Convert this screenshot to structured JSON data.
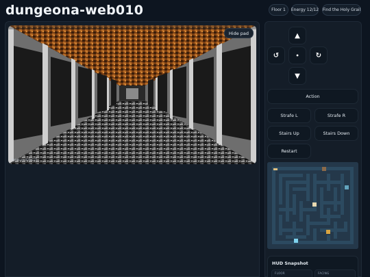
{
  "app": {
    "title": "dungeona-web010"
  },
  "status": {
    "floor": "Floor 1",
    "energy": "Energy 12/12",
    "quest": "Find the Holy Grail"
  },
  "viewport": {
    "hide_pad_label": "Hide pad",
    "render_info": "Renderer 400x225"
  },
  "controls": {
    "forward": "▲",
    "turn_left": "↺",
    "center": "•",
    "turn_right": "↻",
    "back": "▼"
  },
  "actions": {
    "action": "Action",
    "strafe_left": "Strafe L",
    "strafe_right": "Strafe R",
    "stairs_up": "Stairs Up",
    "stairs_down": "Stairs Down",
    "restart": "Restart"
  },
  "hud": {
    "title": "HUD Snapshot",
    "floor_label": "FLOOR",
    "facing_label": "FACING"
  },
  "minimap": {
    "wall_color": "#24384a",
    "floor_color": "#2c4a60",
    "player_color": "#e0c080",
    "stairs_color": "#7fd3ee",
    "item_color": "#d9a441",
    "chest_color": "#8a6a4a"
  }
}
